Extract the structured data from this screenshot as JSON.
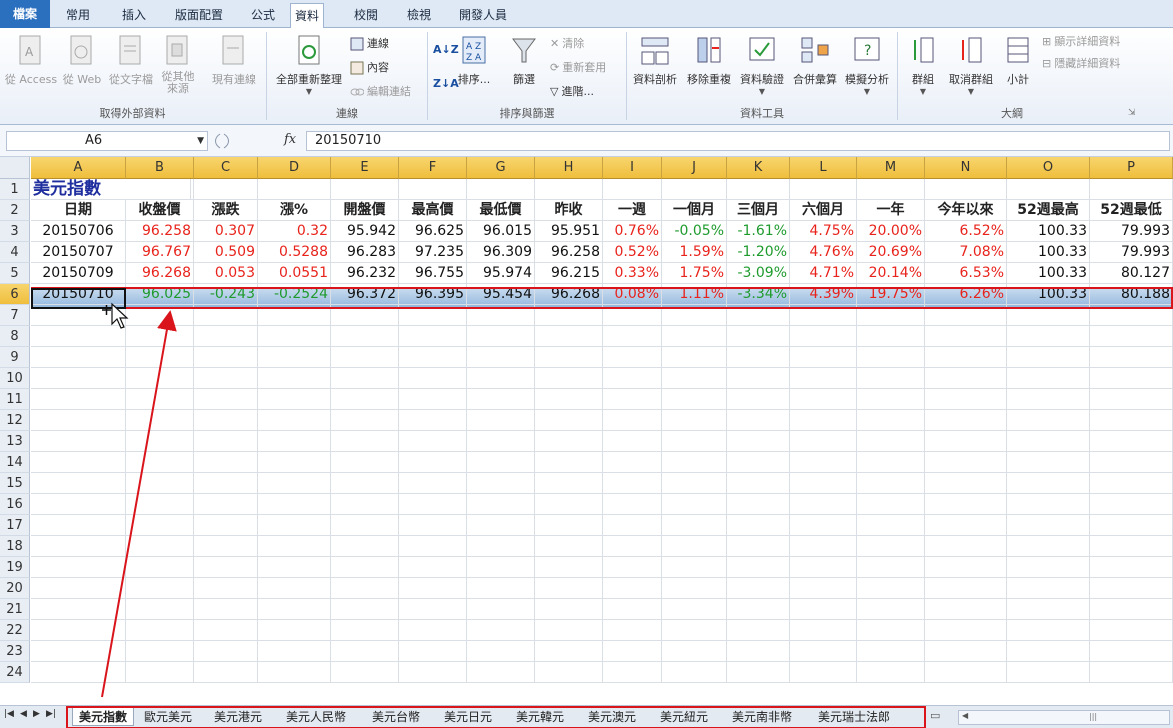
{
  "ribbon_tabs": [
    "檔案",
    "常用",
    "插入",
    "版面配置",
    "公式",
    "資料",
    "校閱",
    "檢視",
    "開發人員"
  ],
  "ribbon": {
    "external": {
      "access": "從 Access",
      "web": "從 Web",
      "text": "從文字檔",
      "other_line1": "從其他",
      "other_line2": "來源",
      "existing": "現有連線",
      "group_label": "取得外部資料"
    },
    "connections": {
      "refresh_all": "全部重新整理",
      "connections": "連線",
      "properties": "內容",
      "edit_links": "編輯連結",
      "group_label": "連線"
    },
    "sort_filter": {
      "sort": "排序...",
      "filter": "篩選",
      "clear": "清除",
      "reapply": "重新套用",
      "advanced": "進階...",
      "group_label": "排序與篩選"
    },
    "data_tools": {
      "text_to_columns": "資料剖析",
      "remove_duplicates": "移除重複",
      "validation": "資料驗證",
      "consolidate": "合併彙算",
      "what_if": "模擬分析",
      "group_label": "資料工具"
    },
    "outline": {
      "group": "群組",
      "ungroup": "取消群組",
      "subtotal": "小計",
      "show_detail": "顯示詳細資料",
      "hide_detail": "隱藏詳細資料",
      "group_label": "大綱"
    }
  },
  "formula_bar": {
    "name_box": "A6",
    "fx": "fx",
    "value": "20150710"
  },
  "columns": [
    "A",
    "B",
    "C",
    "D",
    "E",
    "F",
    "G",
    "H",
    "I",
    "J",
    "K",
    "L",
    "M",
    "N",
    "O",
    "P"
  ],
  "row_numbers": [
    "1",
    "2",
    "3",
    "4",
    "5",
    "6",
    "7",
    "8",
    "9",
    "10",
    "11",
    "12",
    "13",
    "14",
    "15",
    "16",
    "17",
    "18",
    "19",
    "20",
    "21",
    "22",
    "23",
    "24"
  ],
  "sheet": {
    "title": "美元指數",
    "headers": [
      "日期",
      "收盤價",
      "漲跌",
      "漲%",
      "開盤價",
      "最高價",
      "最低價",
      "昨收",
      "一週",
      "一個月",
      "三個月",
      "六個月",
      "一年",
      "今年以來",
      "52週最高",
      "52週最低"
    ],
    "rows": [
      [
        "20150706",
        "96.258",
        "0.307",
        "0.32",
        "95.942",
        "96.625",
        "96.015",
        "95.951",
        "0.76%",
        "-0.05%",
        "-1.61%",
        "4.75%",
        "20.00%",
        "6.52%",
        "100.33",
        "79.993"
      ],
      [
        "20150707",
        "96.767",
        "0.509",
        "0.5288",
        "96.283",
        "97.235",
        "96.309",
        "96.258",
        "0.52%",
        "1.59%",
        "-1.20%",
        "4.76%",
        "20.69%",
        "7.08%",
        "100.33",
        "79.993"
      ],
      [
        "20150709",
        "96.268",
        "0.053",
        "0.0551",
        "96.232",
        "96.755",
        "95.974",
        "96.215",
        "0.33%",
        "1.75%",
        "-3.09%",
        "4.71%",
        "20.14%",
        "6.53%",
        "100.33",
        "80.127"
      ],
      [
        "20150710",
        "96.025",
        "-0.243",
        "-0.2524",
        "96.372",
        "96.395",
        "95.454",
        "96.268",
        "0.08%",
        "1.11%",
        "-3.34%",
        "4.39%",
        "19.75%",
        "6.26%",
        "100.33",
        "80.188"
      ]
    ],
    "colors": {
      "up": "#e8231c",
      "down": "#1f9b2e",
      "title": "#1e2e9e",
      "highlight": "#d9141b"
    }
  },
  "sheet_tabs": [
    "美元指數",
    "歐元美元",
    "美元港元",
    "美元人民幣",
    "美元台幣",
    "美元日元",
    "美元韓元",
    "美元澳元",
    "美元紐元",
    "美元南非幣",
    "美元瑞士法郎"
  ],
  "active_sheet_tab": "美元指數"
}
